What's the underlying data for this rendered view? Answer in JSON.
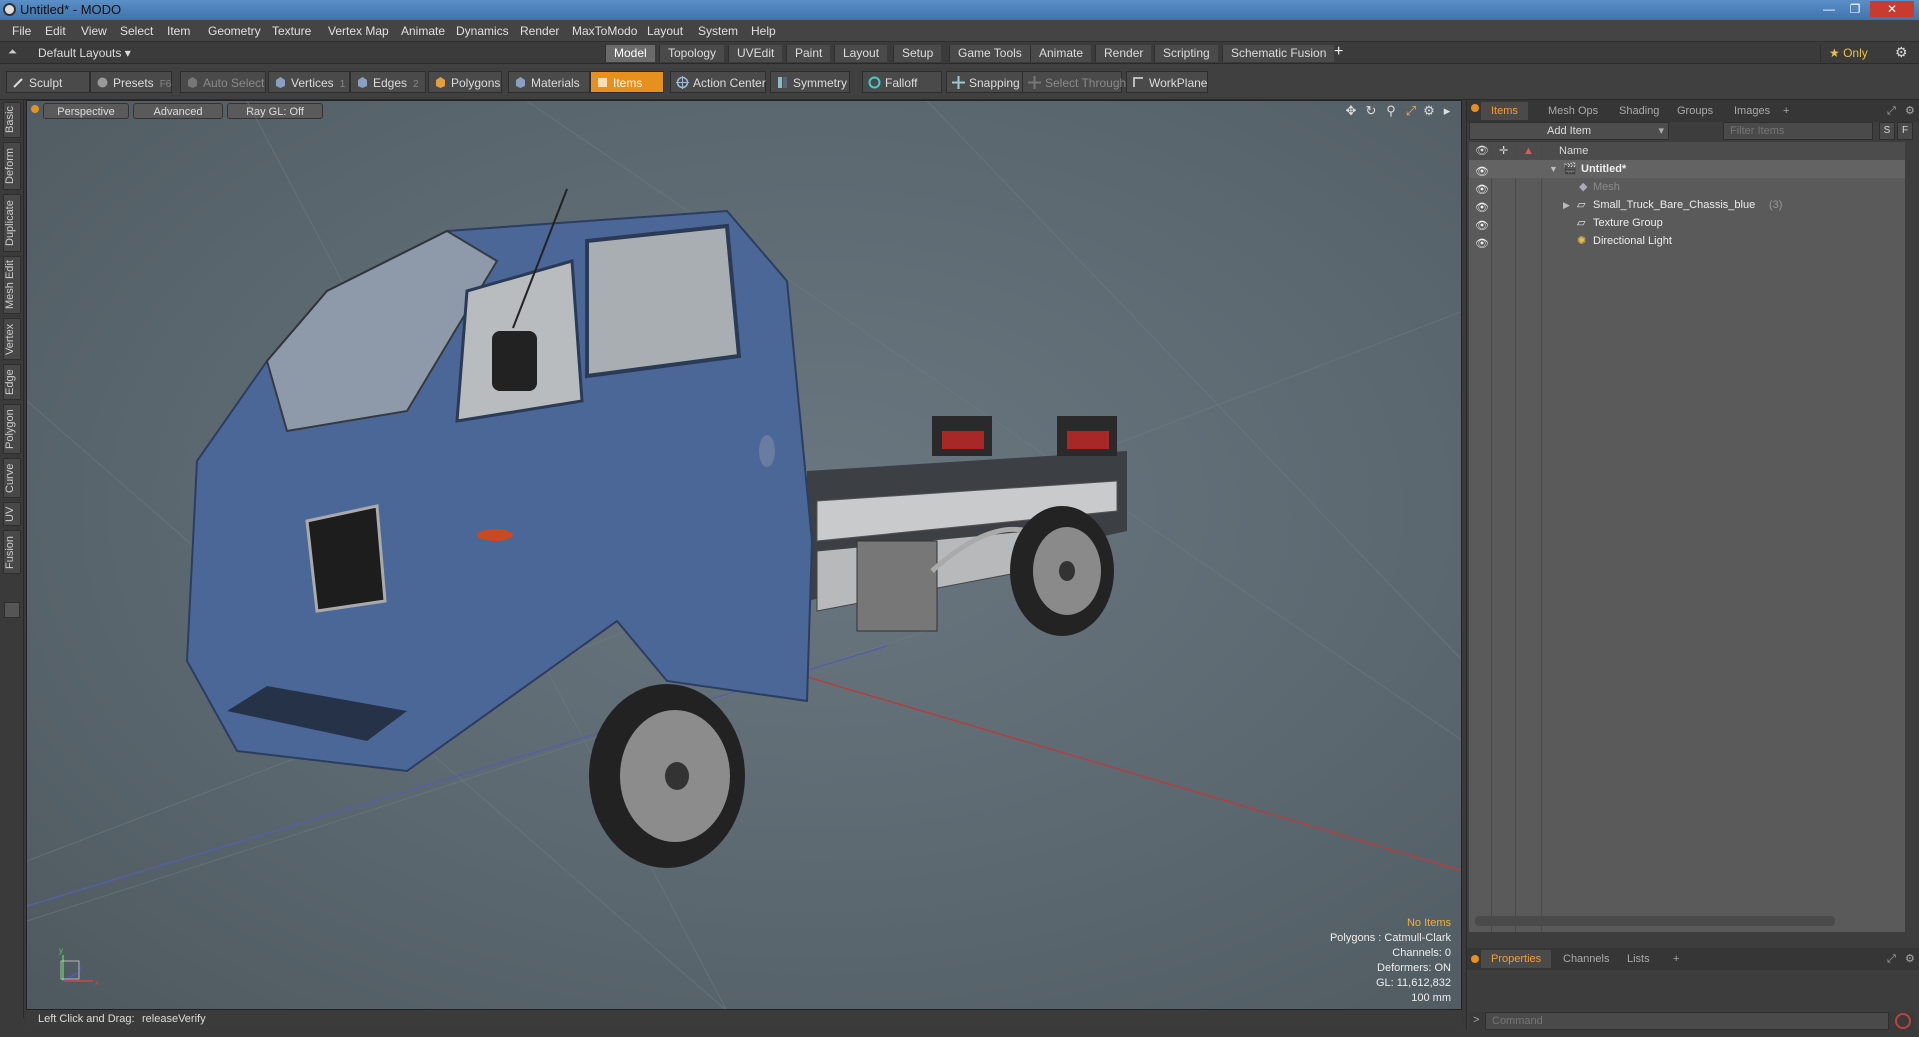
{
  "window": {
    "title": "Untitled* - MODO",
    "controls": [
      "—",
      "❐",
      "✕"
    ]
  },
  "menubar": [
    "File",
    "Edit",
    "View",
    "Select",
    "Item",
    "Geometry",
    "Texture",
    "Vertex Map",
    "Animate",
    "Dynamics",
    "Render",
    "MaxToModo",
    "Layout",
    "System",
    "Help"
  ],
  "layoutbar": {
    "layout_label": "Default Layouts ▾",
    "tabs": [
      "Model",
      "Topology",
      "UVEdit",
      "Paint",
      "Layout",
      "Setup",
      "Game Tools",
      "Animate",
      "Render",
      "Scripting",
      "Schematic Fusion"
    ],
    "active_tab": "Model",
    "add_label": "+",
    "only_label": "★ Only"
  },
  "toolbar": {
    "sculpt": "Sculpt",
    "presets": "Presets",
    "presets_key": "F6",
    "auto_select": "Auto Select",
    "vertices": "Vertices",
    "vertices_key": "1",
    "edges": "Edges",
    "edges_key": "2",
    "polygons": "Polygons",
    "materials": "Materials",
    "items": "Items",
    "action_center": "Action Center",
    "symmetry": "Symmetry",
    "falloff": "Falloff",
    "snapping": "Snapping",
    "select_through": "Select Through",
    "workplane": "WorkPlane"
  },
  "left_tabs": [
    "Basic",
    "Deform",
    "Duplicate",
    "Mesh Edit",
    "Vertex",
    "Edge",
    "Polygon",
    "Curve",
    "UV",
    "Fusion"
  ],
  "viewport": {
    "view_mode": "Perspective",
    "shading": "Advanced",
    "raygl": "Ray GL: Off",
    "hud": {
      "no_items": "No Items",
      "polygons": "Polygons : Catmull-Clark",
      "channels": "Channels: 0",
      "deformers": "Deformers: ON",
      "gl": "GL: 11,612,832",
      "scale": "100 mm"
    },
    "axis": {
      "x": "x",
      "y": "y",
      "z": "z"
    }
  },
  "statusbar": {
    "hint_label": "Left Click and Drag:",
    "hint_value": "releaseVerify"
  },
  "right_panel": {
    "tabs": [
      "Items",
      "Mesh Ops",
      "Shading",
      "Groups",
      "Images"
    ],
    "active_tab": "Items",
    "add_item": "Add Item",
    "filter_placeholder": "Filter Items",
    "filter_btn_s": "S",
    "filter_btn_f": "F",
    "name_header": "Name",
    "items": [
      {
        "label": "Untitled*",
        "bold": true,
        "indent": 0,
        "expander": "▼"
      },
      {
        "label": "Mesh",
        "dim": true,
        "indent": 1,
        "expander": ""
      },
      {
        "label": "Small_Truck_Bare_Chassis_blue",
        "count": "(3)",
        "indent": 1,
        "expander": "▶"
      },
      {
        "label": "Texture Group",
        "indent": 1,
        "expander": ""
      },
      {
        "label": "Directional Light",
        "indent": 1,
        "expander": ""
      }
    ],
    "bottom_tabs": [
      "Properties",
      "Channels",
      "Lists"
    ],
    "bottom_active": "Properties",
    "command_placeholder": "Command"
  },
  "colors": {
    "accent": "#e8901e",
    "viewport_bg": "#5f6b73",
    "truck_blue": "#4a6798"
  }
}
